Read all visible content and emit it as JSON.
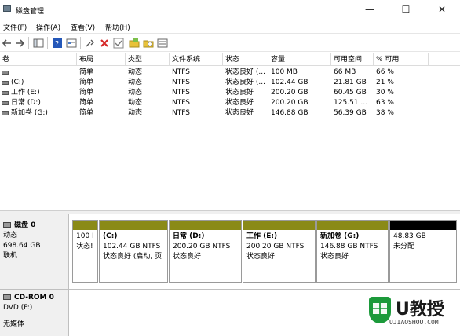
{
  "window": {
    "title": "磁盘管理",
    "controls": {
      "minimize": "—",
      "maximize": "☐",
      "close": "✕"
    }
  },
  "menu": [
    "文件(F)",
    "操作(A)",
    "查看(V)",
    "帮助(H)"
  ],
  "toolbar": {
    "icons": [
      "back-icon",
      "forward-icon",
      "console-tree-icon",
      "help-icon",
      "properties-icon",
      "connect-icon",
      "delete-icon",
      "check-icon",
      "folder-icon",
      "search-folder-icon",
      "list-icon"
    ],
    "colors": {
      "delete": "#d62828",
      "help": "#2457b8",
      "folder": "#e8c23a"
    }
  },
  "volume_list": {
    "headers": [
      "卷",
      "布局",
      "类型",
      "文件系统",
      "状态",
      "容量",
      "可用空间",
      "% 可用"
    ],
    "rows": [
      {
        "volume": "",
        "layout": "简单",
        "type": "动态",
        "fs": "NTFS",
        "status": "状态良好 (...",
        "capacity": "100 MB",
        "free": "66 MB",
        "pct": "66 %"
      },
      {
        "volume": "(C:)",
        "layout": "简单",
        "type": "动态",
        "fs": "NTFS",
        "status": "状态良好 (...",
        "capacity": "102.44 GB",
        "free": "21.81 GB",
        "pct": "21 %"
      },
      {
        "volume": "工作 (E:)",
        "layout": "简单",
        "type": "动态",
        "fs": "NTFS",
        "status": "状态良好",
        "capacity": "200.20 GB",
        "free": "60.45 GB",
        "pct": "30 %"
      },
      {
        "volume": "日常 (D:)",
        "layout": "简单",
        "type": "动态",
        "fs": "NTFS",
        "status": "状态良好",
        "capacity": "200.20 GB",
        "free": "125.51 ...",
        "pct": "63 %"
      },
      {
        "volume": "新加卷 (G:)",
        "layout": "简单",
        "type": "动态",
        "fs": "NTFS",
        "status": "状态良好",
        "capacity": "146.88 GB",
        "free": "56.39 GB",
        "pct": "38 %"
      }
    ]
  },
  "disk0": {
    "name": "磁盘 0",
    "type": "动态",
    "size": "698.64 GB",
    "state": "联机",
    "partitions": [
      {
        "title": "",
        "line1": "100 I",
        "line2": "状态!"
      },
      {
        "title": "(C:)",
        "line1": "102.44 GB NTFS",
        "line2": "状态良好 (启动, 页"
      },
      {
        "title": "日常  (D:)",
        "line1": "200.20 GB NTFS",
        "line2": "状态良好"
      },
      {
        "title": "工作  (E:)",
        "line1": "200.20 GB NTFS",
        "line2": "状态良好"
      },
      {
        "title": "新加卷  (G:)",
        "line1": "146.88 GB NTFS",
        "line2": "状态良好"
      },
      {
        "title": "",
        "line1": "48.83 GB",
        "line2": "未分配"
      }
    ],
    "colors": {
      "simple_volume": "#8a8a17",
      "unallocated": "#000000"
    }
  },
  "cdrom0": {
    "name": "CD-ROM 0",
    "drive": "DVD (F:)",
    "media": "无媒体"
  },
  "watermark": {
    "brand": "U教授",
    "site": "UJIAOSHOU.COM",
    "color": "#1c9a3b"
  }
}
